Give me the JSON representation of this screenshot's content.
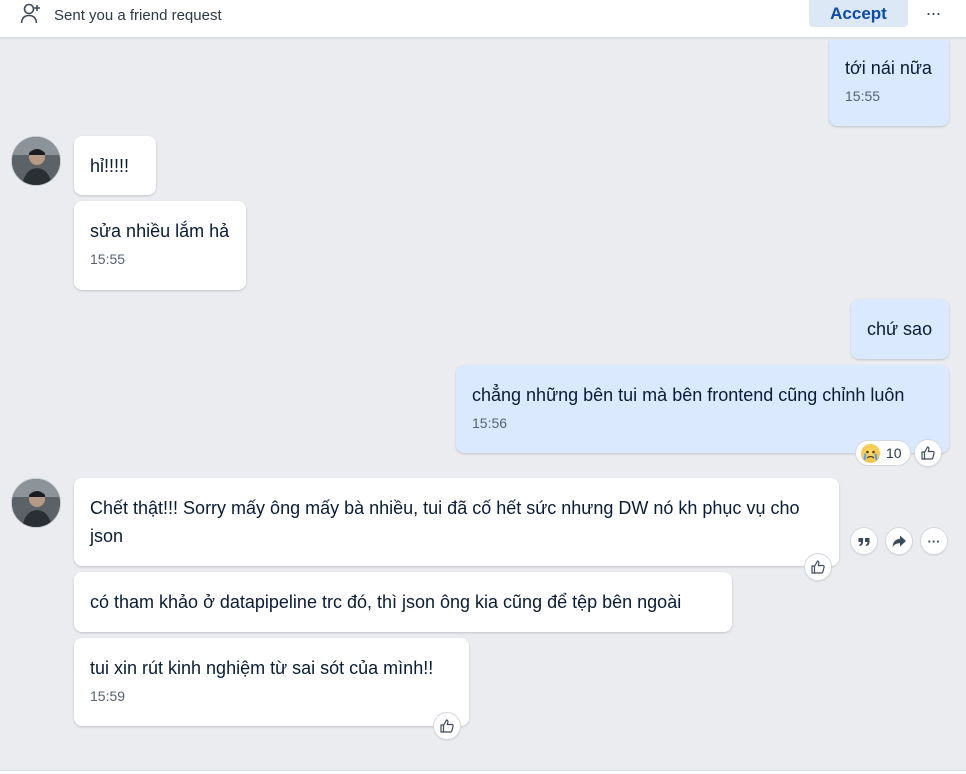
{
  "friend_request": {
    "text": "Sent you a friend request",
    "accept_label": "Accept",
    "more_label": "···"
  },
  "messages": [
    {
      "side": "out",
      "text": "tới nái nữa",
      "time": "15:55"
    },
    {
      "side": "in",
      "text": "hỉ!!!!!"
    },
    {
      "side": "in",
      "text": "sửa nhiều lắm hả",
      "time": "15:55"
    },
    {
      "side": "out",
      "text": "chứ sao"
    },
    {
      "side": "out",
      "text": "chẳng những bên tui mà bên frontend cũng chỉnh luôn",
      "time": "15:56",
      "reaction": {
        "emoji": "crying-face",
        "count": "10"
      }
    },
    {
      "side": "in",
      "text": "Chết thật!!! Sorry mấy ông mấy bà nhiều, tui đã cố hết sức nhưng DW nó kh phục vụ cho json"
    },
    {
      "side": "in",
      "text": "có tham khảo ở datapipeline trc đó, thì json ông kia cũng để tệp bên ngoài"
    },
    {
      "side": "in",
      "text": "tui xin rút kinh nghiệm từ sai sót của mình!!",
      "time": "15:59"
    }
  ],
  "message_actions": {
    "quote_icon": "quote-icon",
    "forward_icon": "forward-icon",
    "more_label": "···"
  },
  "colors": {
    "background": "#ebecf0",
    "outgoing_bubble": "#dbe9fe",
    "incoming_bubble": "#ffffff",
    "accept_text": "#0a4bab",
    "accept_bg": "#dde8f7"
  }
}
